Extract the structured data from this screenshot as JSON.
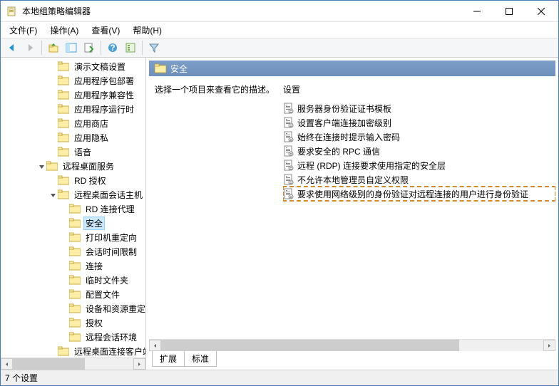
{
  "window": {
    "title": "本地组策略编辑器"
  },
  "menu": {
    "file": "文件(F)",
    "action": "操作(A)",
    "view": "查看(V)",
    "help": "帮助(H)"
  },
  "tree": {
    "items": [
      {
        "indent": 5,
        "label": "演示文稿设置"
      },
      {
        "indent": 5,
        "label": "应用程序包部署"
      },
      {
        "indent": 5,
        "label": "应用程序兼容性"
      },
      {
        "indent": 5,
        "label": "应用程序运行时"
      },
      {
        "indent": 5,
        "label": "应用商店"
      },
      {
        "indent": 5,
        "label": "应用隐私"
      },
      {
        "indent": 5,
        "label": "语音"
      },
      {
        "indent": 4,
        "label": "远程桌面服务",
        "expander": "open"
      },
      {
        "indent": 5,
        "label": "RD 授权"
      },
      {
        "indent": 5,
        "label": "远程桌面会话主机",
        "expander": "open"
      },
      {
        "indent": 6,
        "label": "RD 连接代理"
      },
      {
        "indent": 6,
        "label": "安全",
        "selected": true
      },
      {
        "indent": 6,
        "label": "打印机重定向"
      },
      {
        "indent": 6,
        "label": "会话时间限制"
      },
      {
        "indent": 6,
        "label": "连接"
      },
      {
        "indent": 6,
        "label": "临时文件夹"
      },
      {
        "indent": 6,
        "label": "配置文件"
      },
      {
        "indent": 6,
        "label": "设备和资源重定向"
      },
      {
        "indent": 6,
        "label": "授权"
      },
      {
        "indent": 6,
        "label": "远程会话环境"
      },
      {
        "indent": 5,
        "label": "远程桌面连接客户端"
      }
    ]
  },
  "detail": {
    "header": "安全",
    "description": "选择一个项目来查看它的描述。",
    "settings_header": "设置",
    "settings": [
      {
        "label": "服务器身份验证证书模板"
      },
      {
        "label": "设置客户端连接加密级别"
      },
      {
        "label": "始终在连接时提示输入密码"
      },
      {
        "label": "要求安全的 RPC 通信"
      },
      {
        "label": "远程 (RDP) 连接要求使用指定的安全层"
      },
      {
        "label": "不允许本地管理员自定义权限"
      },
      {
        "label": "要求使用网络级别的身份验证对远程连接的用户进行身份验证",
        "highlight": true
      }
    ]
  },
  "tabs": {
    "extended": "扩展",
    "standard": "标准"
  },
  "status": {
    "text": "7 个设置"
  }
}
